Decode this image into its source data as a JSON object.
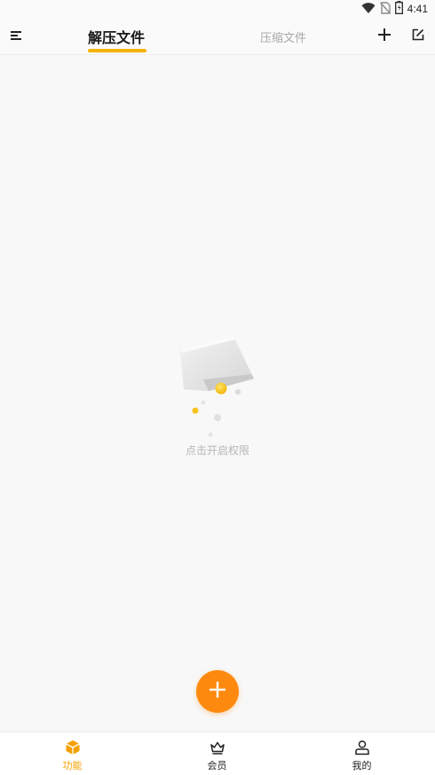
{
  "status_bar": {
    "time": "4:41",
    "icons": [
      "wifi-icon",
      "no-sim-icon",
      "battery-icon"
    ]
  },
  "header": {
    "menu_icon": "menu-icon",
    "tabs": [
      {
        "label": "解压文件",
        "active": true
      },
      {
        "label": "压缩文件",
        "active": false
      }
    ],
    "actions": [
      "add-icon",
      "edit-icon"
    ]
  },
  "main": {
    "empty_hint": "点击开启权限"
  },
  "fab": {
    "icon": "plus-icon"
  },
  "bottom_nav": {
    "items": [
      {
        "label": "功能",
        "icon": "box-icon",
        "active": true
      },
      {
        "label": "会员",
        "icon": "crown-icon",
        "active": false
      },
      {
        "label": "我的",
        "icon": "user-icon",
        "active": false
      }
    ]
  },
  "colors": {
    "accent": "#fd8a0f",
    "tab_underline": "#f4b400",
    "active_label": "#f4a000",
    "muted_text": "#b5b5b5"
  }
}
